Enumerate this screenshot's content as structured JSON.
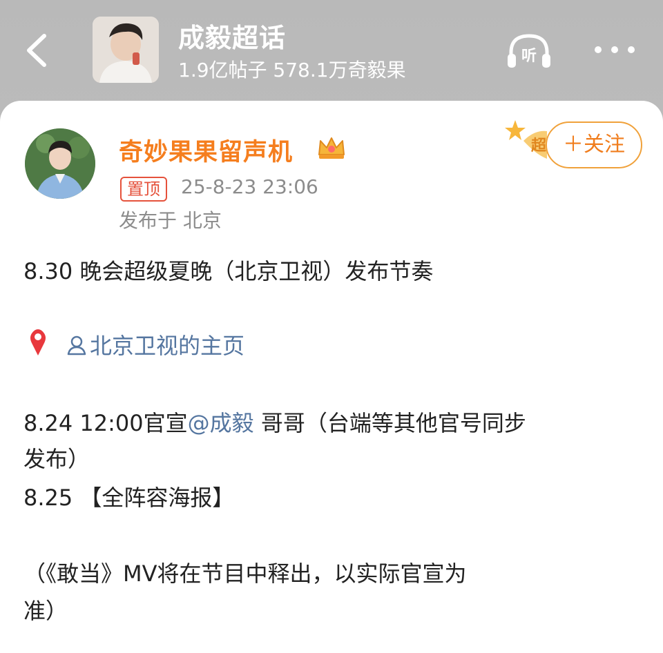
{
  "header": {
    "topic_title": "成毅超话",
    "topic_stats": "1.9亿帖子 578.1万奇毅果"
  },
  "post": {
    "author": "奇妙果果留声机",
    "pinned_label": "置顶",
    "time": "25-8-23 23:06",
    "location": "发布于 北京",
    "follow_label": "＋关注",
    "lines": [
      "8.30 晚会超级夏晚（北京卫视）发布节奏",
      "北京卫视的主页",
      "8.24 12:00官宣",
      "@成毅",
      " 哥哥（台端等其他官号同步",
      "发布）",
      "8.25 【全阵容海报】",
      "（《敢当》MV将在节目中释出，以实际官宣为",
      "准）"
    ]
  },
  "colors": {
    "accent_orange": "#f57e1e",
    "link_blue": "#5576a0",
    "pin_red": "#e5513b"
  },
  "icons": [
    "back-arrow-icon",
    "headphones-listen-icon",
    "more-dots-icon",
    "crown-icon",
    "star-icon",
    "location-pin-icon",
    "person-icon"
  ]
}
